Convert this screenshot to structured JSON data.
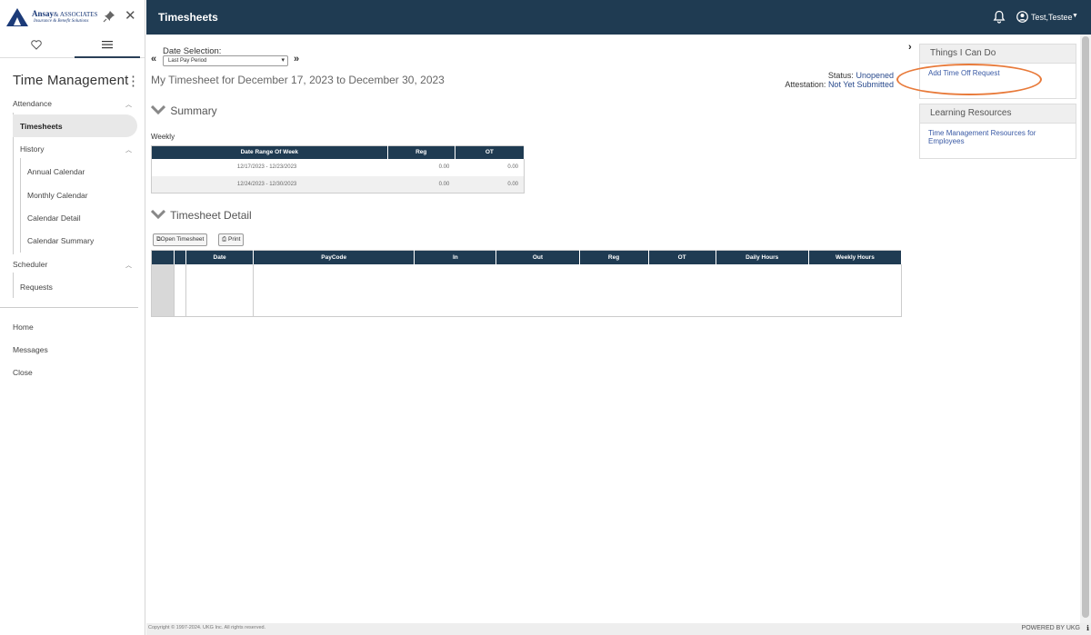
{
  "brand": {
    "logo_name": "Ansay",
    "logo_suffix": "& ASSOCIATES",
    "logo_tagline": "Insurance & Benefit Solutions"
  },
  "sidebar": {
    "module_title": "Time Management",
    "sections": {
      "attendance": "Attendance",
      "timesheets": "Timesheets",
      "history": "History",
      "annual_calendar": "Annual Calendar",
      "monthly_calendar": "Monthly Calendar",
      "calendar_detail": "Calendar Detail",
      "calendar_summary": "Calendar Summary",
      "scheduler": "Scheduler",
      "requests": "Requests"
    },
    "bottom": {
      "home": "Home",
      "messages": "Messages",
      "close": "Close"
    }
  },
  "header": {
    "title": "Timesheets",
    "user": "Test,Testee"
  },
  "main": {
    "date_selection_label": "Date Selection:",
    "date_selection_value": "Last Pay Period",
    "timesheet_title": "My Timesheet for December 17, 2023 to December 30, 2023",
    "status_label": "Status:",
    "status_value": "Unopened",
    "attestation_label": "Attestation:",
    "attestation_value": "Not Yet Submitted",
    "summary_heading": "Summary",
    "weekly_label": "Weekly",
    "summary_table": {
      "headers": [
        "Date Range Of Week",
        "Reg",
        "OT"
      ],
      "rows": [
        [
          "12/17/2023 - 12/23/2023",
          "0.00",
          "0.00"
        ],
        [
          "12/24/2023 - 12/30/2023",
          "0.00",
          "0.00"
        ]
      ]
    },
    "detail_heading": "Timesheet Detail",
    "open_timesheet_button": "Open Timesheet",
    "print_button": "Print",
    "detail_table": {
      "headers": [
        "Date",
        "PayCode",
        "In",
        "Out",
        "Reg",
        "OT",
        "Daily Hours",
        "Weekly Hours"
      ]
    }
  },
  "right_panel": {
    "things_heading": "Things I Can Do",
    "add_time_off": "Add Time Off Request",
    "learning_heading": "Learning Resources",
    "learning_link": "Time Management Resources for Employees"
  },
  "footer": {
    "copyright": "Copyright © 1997-2024. UKG Inc. All rights reserved.",
    "powered": "POWERED BY UKG"
  },
  "colors": {
    "header_bg": "#1f3b52",
    "link": "#3a5aa5",
    "highlight": "#e87a3a"
  }
}
